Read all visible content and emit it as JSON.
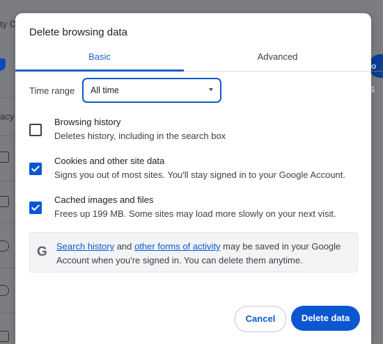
{
  "background": {
    "fragments": [
      "ty C",
      "acy"
    ]
  },
  "dialog": {
    "title": "Delete browsing data",
    "tabs": [
      {
        "label": "Basic",
        "active": true
      },
      {
        "label": "Advanced",
        "active": false
      }
    ],
    "time_range": {
      "label": "Time range",
      "value": "All time"
    },
    "options": [
      {
        "title": "Browsing history",
        "description": "Deletes history, including in the search box",
        "checked": false
      },
      {
        "title": "Cookies and other site data",
        "description": "Signs you out of most sites. You'll stay signed in to your Google Account.",
        "checked": true
      },
      {
        "title": "Cached images and files",
        "description": "Frees up 199 MB. Some sites may load more slowly on your next visit.",
        "checked": true
      }
    ],
    "notice": {
      "icon": "google-g-icon",
      "link1": "Search history",
      "text1": " and ",
      "link2": "other forms of activity",
      "text2": " may be saved in your Google Account when you're signed in. You can delete them anytime."
    },
    "buttons": {
      "cancel": "Cancel",
      "delete": "Delete data"
    },
    "colors": {
      "accent": "#0b57d0",
      "tab_active": "#1a5fcb"
    }
  }
}
